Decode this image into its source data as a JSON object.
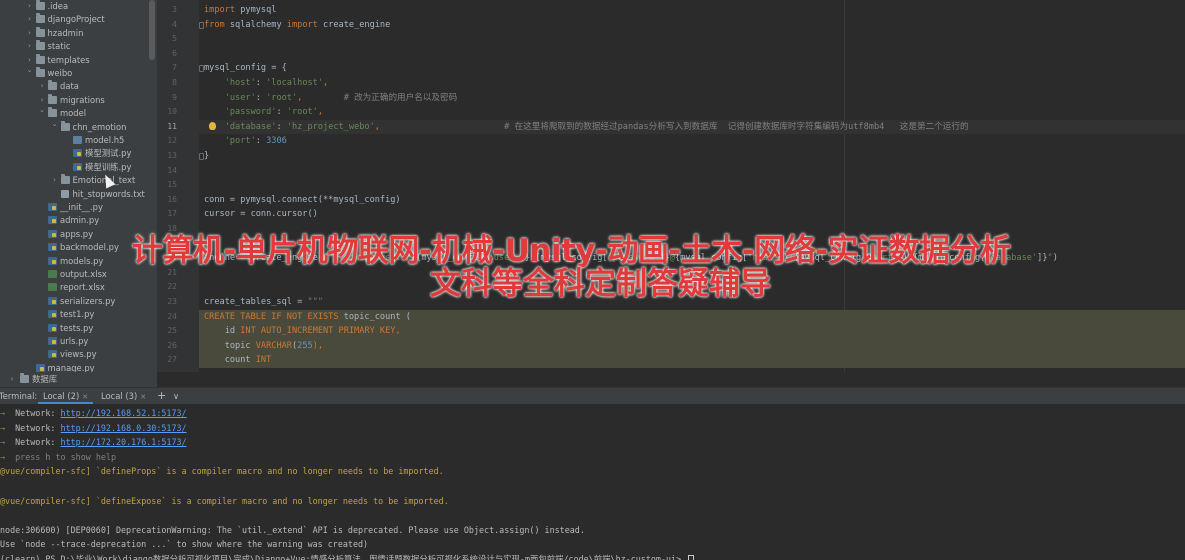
{
  "project_tree": {
    "items": [
      {
        "label": ".idea",
        "type": "folder",
        "depth": 3,
        "expanded": false
      },
      {
        "label": "djangoProject",
        "type": "folder",
        "depth": 3,
        "expanded": false
      },
      {
        "label": "hzadmin",
        "type": "folder",
        "depth": 3,
        "expanded": false
      },
      {
        "label": "static",
        "type": "folder",
        "depth": 3,
        "expanded": false
      },
      {
        "label": "templates",
        "type": "folder",
        "depth": 3,
        "expanded": false
      },
      {
        "label": "weibo",
        "type": "folder",
        "depth": 3,
        "expanded": true
      },
      {
        "label": "data",
        "type": "folder",
        "depth": 4,
        "expanded": false
      },
      {
        "label": "migrations",
        "type": "folder",
        "depth": 4,
        "expanded": false
      },
      {
        "label": "model",
        "type": "folder",
        "depth": 4,
        "expanded": true
      },
      {
        "label": "chn_emotion",
        "type": "folder",
        "depth": 5,
        "expanded": true
      },
      {
        "label": "model.h5",
        "type": "h5",
        "depth": 6
      },
      {
        "label": "模型测试.py",
        "type": "py",
        "depth": 6
      },
      {
        "label": "模型训练.py",
        "type": "py",
        "depth": 6
      },
      {
        "label": "Emotional_text",
        "type": "folder",
        "depth": 5,
        "expanded": false
      },
      {
        "label": "hit_stopwords.txt",
        "type": "txt",
        "depth": 5
      },
      {
        "label": "__init__.py",
        "type": "py",
        "depth": 4
      },
      {
        "label": "admin.py",
        "type": "py",
        "depth": 4
      },
      {
        "label": "apps.py",
        "type": "py",
        "depth": 4
      },
      {
        "label": "backmodel.py",
        "type": "py",
        "depth": 4
      },
      {
        "label": "models.py",
        "type": "py",
        "depth": 4
      },
      {
        "label": "output.xlsx",
        "type": "xlsx",
        "depth": 4
      },
      {
        "label": "report.xlsx",
        "type": "xlsx",
        "depth": 4
      },
      {
        "label": "serializers.py",
        "type": "py",
        "depth": 4
      },
      {
        "label": "test1.py",
        "type": "py",
        "depth": 4
      },
      {
        "label": "tests.py",
        "type": "py",
        "depth": 4
      },
      {
        "label": "urls.py",
        "type": "py",
        "depth": 4
      },
      {
        "label": "views.py",
        "type": "py",
        "depth": 4
      },
      {
        "label": "manage.py",
        "type": "py",
        "depth": 3
      }
    ],
    "bottom_item": {
      "label": "数据库",
      "type": "folder",
      "expanded": false
    }
  },
  "editor": {
    "current_line": 11,
    "lines": [
      {
        "n": "3",
        "segments": [
          {
            "t": "import",
            "c": "k"
          },
          {
            "t": " pymysql",
            "c": ""
          }
        ]
      },
      {
        "n": "4",
        "segments": [
          {
            "t": "from",
            "c": "k"
          },
          {
            "t": " sqlalchemy ",
            "c": ""
          },
          {
            "t": "import",
            "c": "k"
          },
          {
            "t": " create_engine",
            "c": ""
          }
        ]
      },
      {
        "n": "5",
        "segments": []
      },
      {
        "n": "6",
        "segments": []
      },
      {
        "n": "7",
        "segments": [
          {
            "t": "mysql_config = {",
            "c": ""
          }
        ]
      },
      {
        "n": "8",
        "segments": [
          {
            "t": "    ",
            "c": ""
          },
          {
            "t": "'host'",
            "c": "s"
          },
          {
            "t": ": ",
            "c": ""
          },
          {
            "t": "'localhost'",
            "c": "s"
          },
          {
            "t": ",",
            "c": "k"
          }
        ]
      },
      {
        "n": "9",
        "segments": [
          {
            "t": "    ",
            "c": ""
          },
          {
            "t": "'user'",
            "c": "s"
          },
          {
            "t": ": ",
            "c": ""
          },
          {
            "t": "'root'",
            "c": "s"
          },
          {
            "t": ",",
            "c": "k"
          },
          {
            "t": "        # 改为正确的用户名以及密码",
            "c": "c"
          }
        ]
      },
      {
        "n": "10",
        "segments": [
          {
            "t": "    ",
            "c": ""
          },
          {
            "t": "'password'",
            "c": "s"
          },
          {
            "t": ": ",
            "c": ""
          },
          {
            "t": "'root'",
            "c": "s"
          },
          {
            "t": ",",
            "c": "k"
          }
        ]
      },
      {
        "n": "11",
        "segments": [
          {
            "t": "    ",
            "c": ""
          },
          {
            "t": "'database'",
            "c": "s"
          },
          {
            "t": ": ",
            "c": ""
          },
          {
            "t": "'hz_project_webo'",
            "c": "s"
          },
          {
            "t": ",",
            "c": "k"
          },
          {
            "t": "                        # 在这里将爬取到的数据经过pandas分析写入到数据库  记得创建数据库时字符集编码为utf8mb4   这是第二个运行的",
            "c": "c"
          }
        ]
      },
      {
        "n": "12",
        "segments": [
          {
            "t": "    ",
            "c": ""
          },
          {
            "t": "'port'",
            "c": "s"
          },
          {
            "t": ": ",
            "c": ""
          },
          {
            "t": "3306",
            "c": "n"
          }
        ]
      },
      {
        "n": "13",
        "segments": [
          {
            "t": "}",
            "c": ""
          }
        ]
      },
      {
        "n": "14",
        "segments": []
      },
      {
        "n": "15",
        "segments": []
      },
      {
        "n": "16",
        "segments": [
          {
            "t": "conn = pymysql.connect(**mysql_config)",
            "c": ""
          }
        ]
      },
      {
        "n": "17",
        "segments": [
          {
            "t": "cursor = conn.cursor()",
            "c": ""
          }
        ]
      },
      {
        "n": "18",
        "segments": []
      },
      {
        "n": "19",
        "segments": []
      },
      {
        "n": "20",
        "segments": [
          {
            "t": "engine = create_engine(",
            "c": ""
          },
          {
            "t": "f\"mysql+pymysql://",
            "c": "s"
          },
          {
            "t": "{mysql_config[",
            "c": ""
          },
          {
            "t": "'user'",
            "c": "s"
          },
          {
            "t": "]}",
            "c": ""
          },
          {
            "t": ":",
            "c": "s"
          },
          {
            "t": "{mysql_config[",
            "c": ""
          },
          {
            "t": "'password'",
            "c": "s"
          },
          {
            "t": "]}",
            "c": ""
          },
          {
            "t": "@",
            "c": "s"
          },
          {
            "t": "{mysql_config[",
            "c": ""
          },
          {
            "t": "'host'",
            "c": "s"
          },
          {
            "t": "]}",
            "c": ""
          },
          {
            "t": ":",
            "c": "s"
          },
          {
            "t": "{mysql_config[",
            "c": ""
          },
          {
            "t": "'port'",
            "c": "s"
          },
          {
            "t": "]}",
            "c": ""
          },
          {
            "t": "/",
            "c": "s"
          },
          {
            "t": "{mysql_config[",
            "c": ""
          },
          {
            "t": "'database'",
            "c": "s"
          },
          {
            "t": "]}",
            "c": ""
          },
          {
            "t": "\"",
            "c": "s"
          },
          {
            "t": ")",
            "c": ""
          }
        ]
      },
      {
        "n": "21",
        "segments": []
      },
      {
        "n": "22",
        "segments": []
      },
      {
        "n": "23",
        "segments": [
          {
            "t": "create_tables_sql = ",
            "c": ""
          },
          {
            "t": "\"\"\"",
            "c": "s"
          }
        ]
      },
      {
        "n": "24",
        "segments": [
          {
            "t": "CREATE TABLE IF NOT EXISTS",
            "c": "sql-t"
          },
          {
            "t": " topic_count (",
            "c": ""
          }
        ]
      },
      {
        "n": "25",
        "segments": [
          {
            "t": "    id ",
            "c": ""
          },
          {
            "t": "INT AUTO_INCREMENT PRIMARY KEY",
            "c": "sql-t"
          },
          {
            "t": ",",
            "c": "sql-t"
          }
        ]
      },
      {
        "n": "26",
        "segments": [
          {
            "t": "    topic ",
            "c": ""
          },
          {
            "t": "VARCHAR",
            "c": "sql-t"
          },
          {
            "t": "(",
            "c": ""
          },
          {
            "t": "255",
            "c": "n"
          },
          {
            "t": "),",
            "c": "sql-t"
          }
        ]
      },
      {
        "n": "27",
        "segments": [
          {
            "t": "    count ",
            "c": ""
          },
          {
            "t": "INT",
            "c": "sql-t"
          }
        ]
      }
    ]
  },
  "watermark": {
    "line1": "计算机-单片机物联网-机械-Unity-动画-土木-网络-实证数据分析",
    "line2": "文科等全科定制答疑辅导"
  },
  "terminal": {
    "label": "Terminal:",
    "tabs": [
      "Local (2)",
      "Local (3)"
    ],
    "add_label": "+",
    "dropdown_label": "∨",
    "lines": [
      {
        "segments": [
          {
            "t": "→  ",
            "c": "tgreen"
          },
          {
            "t": "Network: ",
            "c": ""
          },
          {
            "t": "http://192.168.52.1:5173/",
            "c": "tlink"
          }
        ]
      },
      {
        "segments": [
          {
            "t": "→  ",
            "c": "tgreen"
          },
          {
            "t": "Network: ",
            "c": ""
          },
          {
            "t": "http://192.168.0.30:5173/",
            "c": "tlink"
          }
        ]
      },
      {
        "segments": [
          {
            "t": "→  ",
            "c": "tgreen"
          },
          {
            "t": "Network: ",
            "c": ""
          },
          {
            "t": "http://172.20.176.1:5173/",
            "c": "tlink"
          }
        ]
      },
      {
        "segments": [
          {
            "t": "→  ",
            "c": "tgreen"
          },
          {
            "t": "press h to show help",
            "c": "tgray"
          }
        ]
      },
      {
        "segments": [
          {
            "t": "@vue/compiler-sfc] ",
            "c": "tyellow"
          },
          {
            "t": "`defineProps` is a compiler macro and no longer needs to be imported.",
            "c": "tyellow"
          }
        ]
      },
      {
        "segments": []
      },
      {
        "segments": [
          {
            "t": "@vue/compiler-sfc] ",
            "c": "tyellow"
          },
          {
            "t": "`defineExpose` is a compiler macro and no longer needs to be imported.",
            "c": "tyellow"
          }
        ]
      },
      {
        "segments": []
      },
      {
        "segments": [
          {
            "t": "node:306600) [DEP0060] DeprecationWarning: The `util._extend` API is deprecated. Please use Object.assign() instead.",
            "c": ""
          }
        ]
      },
      {
        "segments": [
          {
            "t": "Use `node --trace-deprecation ...` to show where the warning was created)",
            "c": ""
          }
        ]
      },
      {
        "segments": [
          {
            "t": "(clearn) PS D:\\毕业\\Work\\django数据分析可视化项目\\完成\\Django+Vue:情感分析算法，舆情话题数据分析可视化系统设计与实现-m面包前端/code\\前端\\hz-custom-ui> ",
            "c": ""
          }
        ],
        "caret": true
      }
    ]
  }
}
